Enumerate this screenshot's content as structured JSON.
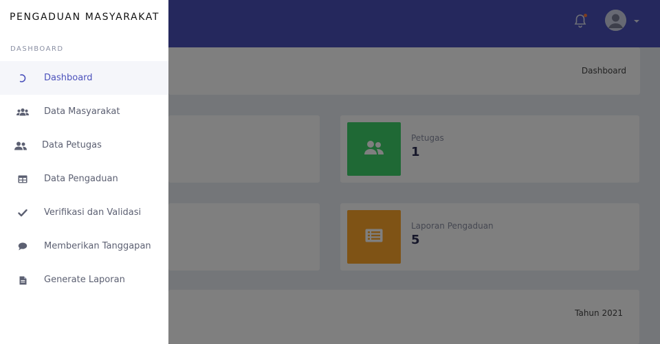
{
  "app": {
    "brand": "PENGADUAN MASYARAKAT"
  },
  "sidebar": {
    "section_label": "DASHBOARD",
    "items": [
      {
        "label": "Dashboard",
        "icon": "dashboard-icon",
        "active": true
      },
      {
        "label": "Data Masyarakat",
        "icon": "users-icon"
      },
      {
        "label": "Data Petugas",
        "icon": "user-friends-icon"
      },
      {
        "label": "Data Pengaduan",
        "icon": "table-icon"
      },
      {
        "label": "Verifikasi dan Validasi",
        "icon": "check-icon"
      },
      {
        "label": "Memberikan Tanggapan",
        "icon": "comment-icon"
      },
      {
        "label": "Generate Laporan",
        "icon": "file-icon"
      }
    ]
  },
  "header": {
    "notification_icon": "bell-icon",
    "avatar_icon": "user-avatar-icon",
    "menu_icon": "caret-down-icon"
  },
  "breadcrumb": {
    "current": "Dashboard"
  },
  "stats": {
    "petugas": {
      "label": "Petugas",
      "value": "1",
      "color": "#3fd36b"
    },
    "laporan": {
      "label": "Laporan Pengaduan",
      "value": "5",
      "color": "#ffa62b"
    }
  },
  "report": {
    "year_label": "Tahun 2021"
  },
  "colors": {
    "primary": "#4b51bb",
    "overlay": "rgba(0,0,0,0.5)"
  }
}
